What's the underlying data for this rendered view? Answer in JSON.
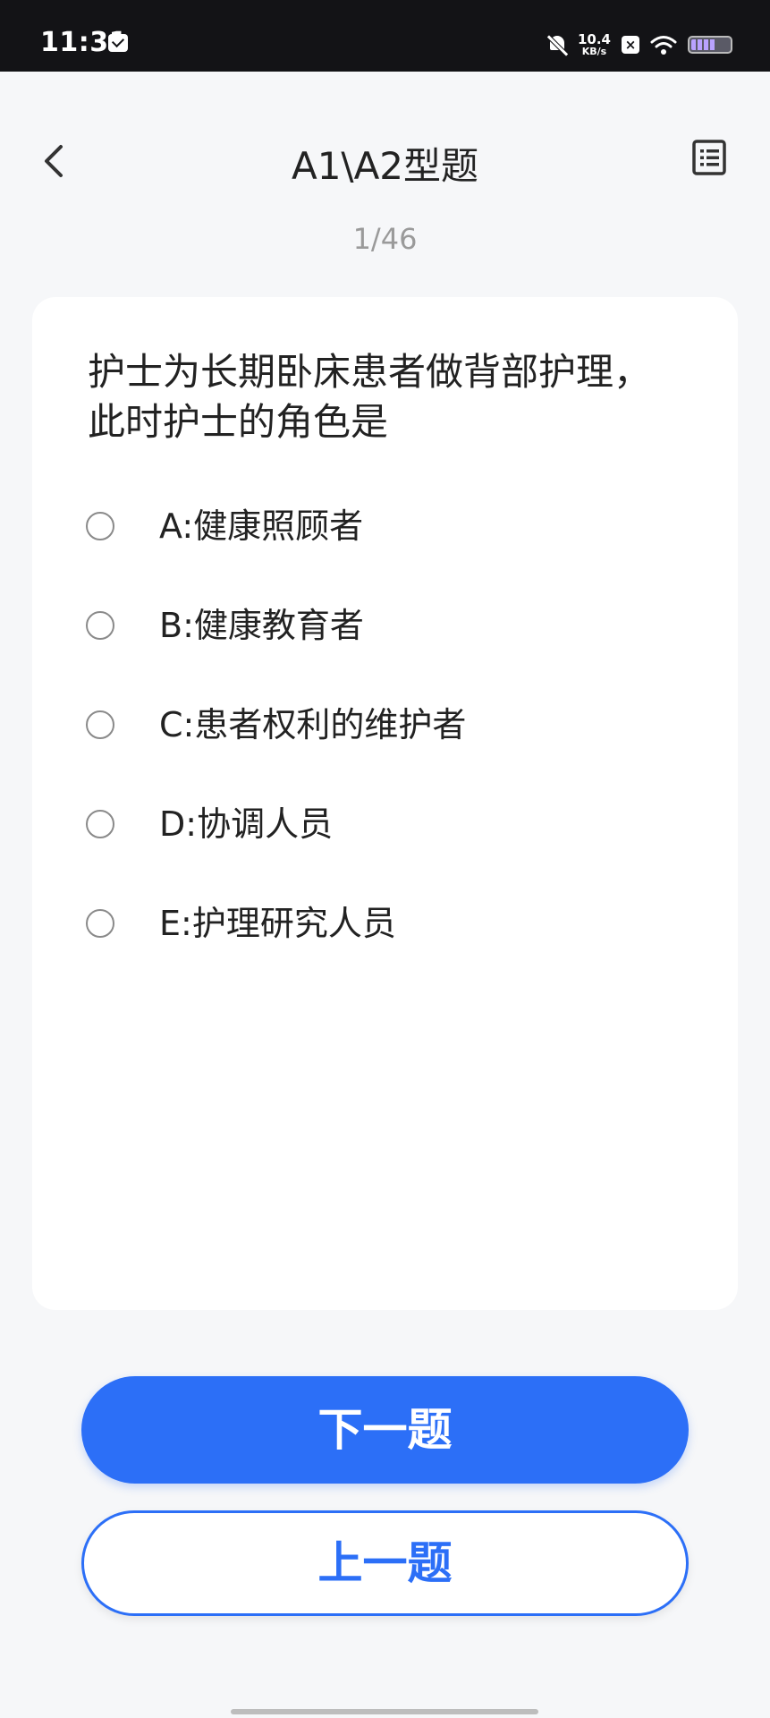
{
  "status_bar": {
    "time": "11:31",
    "net_speed_value": "10.4",
    "net_speed_unit": "KB/s",
    "icons": [
      "message-icon",
      "bell-off-icon",
      "x-app-icon",
      "wifi-icon",
      "battery-icon"
    ]
  },
  "header": {
    "title": "A1\\A2型题",
    "progress": "1/46",
    "back_icon": "chevron-left-icon",
    "menu_icon": "list-icon"
  },
  "question": {
    "text": "护士为长期卧床患者做背部护理，此时护士的角色是",
    "options": [
      {
        "label": "A:健康照顾者",
        "selected": false
      },
      {
        "label": "B:健康教育者",
        "selected": false
      },
      {
        "label": "C:患者权利的维护者",
        "selected": false
      },
      {
        "label": "D:协调人员",
        "selected": false
      },
      {
        "label": "E:护理研究人员",
        "selected": false
      }
    ]
  },
  "actions": {
    "next_label": "下一题",
    "prev_label": "上一题"
  },
  "colors": {
    "accent": "#2c6ff7",
    "background": "#f6f7f9",
    "status_bar": "#131316"
  }
}
